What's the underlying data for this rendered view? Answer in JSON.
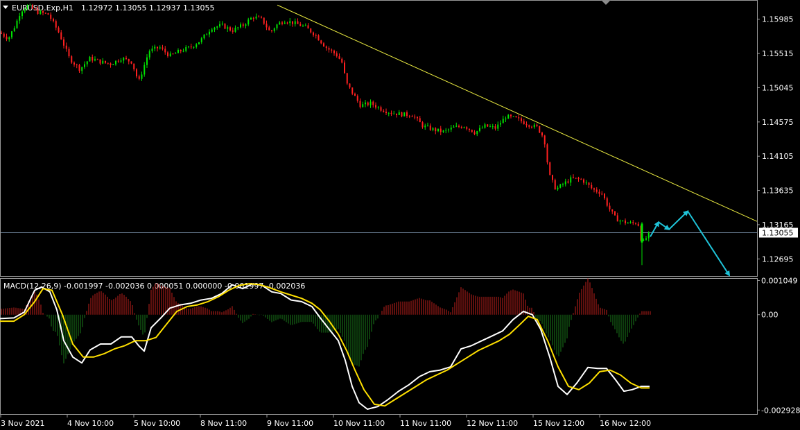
{
  "header": {
    "symbol": "EURUSD.Exp,H1",
    "ohlc": "1.12972 1.13055 1.12937 1.13055"
  },
  "macd_header": {
    "text": "MACD(12,26,9) -0.001997 -0.002036 0.000051 0.000000 -0.001997 -0.002036"
  },
  "chart_data": [
    {
      "type": "candlestick",
      "title": "EURUSD.Exp,H1",
      "ylim": [
        1.1246,
        1.1623
      ],
      "y_ticks": [
        "1.15985",
        "1.15515",
        "1.15045",
        "1.14575",
        "1.14105",
        "1.13635",
        "1.13165",
        "1.12695"
      ],
      "current_price": "1.13055",
      "x_ticks": [
        "3 Nov 2021",
        "4 Nov 10:00",
        "5 Nov 10:00",
        "8 Nov 11:00",
        "9 Nov 11:00",
        "10 Nov 11:00",
        "11 Nov 11:00",
        "12 Nov 11:00",
        "15 Nov 12:00",
        "16 Nov 12:00"
      ],
      "close_path": [
        [
          0,
          1.158
        ],
        [
          12,
          1.1572
        ],
        [
          22,
          1.159
        ],
        [
          30,
          1.161
        ],
        [
          40,
          1.1617
        ],
        [
          55,
          1.1608
        ],
        [
          70,
          1.1605
        ],
        [
          85,
          1.158
        ],
        [
          100,
          1.1545
        ],
        [
          115,
          1.153
        ],
        [
          130,
          1.1545
        ],
        [
          145,
          1.154
        ],
        [
          160,
          1.1537
        ],
        [
          175,
          1.1545
        ],
        [
          190,
          1.154
        ],
        [
          200,
          1.1512
        ],
        [
          215,
          1.1555
        ],
        [
          230,
          1.156
        ],
        [
          245,
          1.1548
        ],
        [
          260,
          1.1555
        ],
        [
          275,
          1.156
        ],
        [
          290,
          1.157
        ],
        [
          305,
          1.1587
        ],
        [
          320,
          1.159
        ],
        [
          335,
          1.1583
        ],
        [
          350,
          1.159
        ],
        [
          365,
          1.1602
        ],
        [
          378,
          1.1598
        ],
        [
          390,
          1.158
        ],
        [
          398,
          1.159
        ],
        [
          410,
          1.1597
        ],
        [
          425,
          1.1593
        ],
        [
          440,
          1.1588
        ],
        [
          455,
          1.1577
        ],
        [
          470,
          1.156
        ],
        [
          485,
          1.155
        ],
        [
          493,
          1.154
        ],
        [
          500,
          1.151
        ],
        [
          510,
          1.1495
        ],
        [
          520,
          1.148
        ],
        [
          535,
          1.1483
        ],
        [
          550,
          1.1475
        ],
        [
          565,
          1.147
        ],
        [
          580,
          1.1468
        ],
        [
          595,
          1.1467
        ],
        [
          610,
          1.1452
        ],
        [
          625,
          1.1447
        ],
        [
          640,
          1.1444
        ],
        [
          655,
          1.145
        ],
        [
          670,
          1.1452
        ],
        [
          685,
          1.1443
        ],
        [
          700,
          1.1452
        ],
        [
          715,
          1.1449
        ],
        [
          730,
          1.1465
        ],
        [
          745,
          1.1462
        ],
        [
          760,
          1.1455
        ],
        [
          775,
          1.145
        ],
        [
          785,
          1.1435
        ],
        [
          792,
          1.1385
        ],
        [
          802,
          1.1365
        ],
        [
          812,
          1.1372
        ],
        [
          825,
          1.138
        ],
        [
          840,
          1.1378
        ],
        [
          855,
          1.1365
        ],
        [
          868,
          1.136
        ],
        [
          878,
          1.134
        ],
        [
          888,
          1.1325
        ],
        [
          900,
          1.132
        ],
        [
          912,
          1.1318
        ],
        [
          920,
          1.132
        ],
        [
          926,
          1.129
        ],
        [
          932,
          1.1298
        ],
        [
          938,
          1.1305
        ]
      ],
      "trendline": [
        [
          400,
          1.1618
        ],
        [
          1092,
          1.1321
        ]
      ],
      "projection_arrows": [
        [
          [
            938,
            1.13
          ],
          [
            950,
            1.132
          ]
        ],
        [
          [
            950,
            1.132
          ],
          [
            965,
            1.131
          ]
        ],
        [
          [
            965,
            1.131
          ],
          [
            992,
            1.1335
          ]
        ],
        [
          [
            992,
            1.1335
          ],
          [
            1052,
            1.1247
          ]
        ]
      ],
      "colors": {
        "bull": "#00e400",
        "bear": "#ff2020",
        "trendline": "#e8e840",
        "arrow": "#1fc3d8",
        "current_line": "#6b7f95"
      }
    },
    {
      "type": "line",
      "title": "MACD(12,26,9)",
      "ylim": [
        -0.00305,
        0.00108
      ],
      "y_ticks": [
        "0.001049",
        "0.00",
        "-0.002928"
      ],
      "series": [
        {
          "name": "MACD",
          "color": "#ffffff",
          "points": [
            [
              0,
              -0.00012
            ],
            [
              20,
              -0.0001
            ],
            [
              35,
              8e-05
            ],
            [
              50,
              0.00075
            ],
            [
              60,
              0.00085
            ],
            [
              72,
              0.0007
            ],
            [
              82,
              0.00015
            ],
            [
              92,
              -0.0008
            ],
            [
              105,
              -0.0013
            ],
            [
              118,
              -0.00148
            ],
            [
              130,
              -0.00108
            ],
            [
              145,
              -0.0009
            ],
            [
              160,
              -0.0009
            ],
            [
              175,
              -0.00068
            ],
            [
              190,
              -0.00068
            ],
            [
              200,
              -0.00095
            ],
            [
              208,
              -0.00112
            ],
            [
              218,
              -0.0004
            ],
            [
              232,
              -0.0001
            ],
            [
              245,
              0.0002
            ],
            [
              260,
              0.0003
            ],
            [
              275,
              0.00035
            ],
            [
              290,
              0.00045
            ],
            [
              305,
              0.0005
            ],
            [
              320,
              0.00065
            ],
            [
              335,
              0.00092
            ],
            [
              350,
              0.0008
            ],
            [
              365,
              0.00095
            ],
            [
              378,
              0.0009
            ],
            [
              392,
              0.0007
            ],
            [
              405,
              0.00065
            ],
            [
              420,
              0.00045
            ],
            [
              435,
              0.0004
            ],
            [
              450,
              0.00025
            ],
            [
              462,
              -0.0001
            ],
            [
              475,
              -0.00045
            ],
            [
              488,
              -0.0008
            ],
            [
              498,
              -0.0014
            ],
            [
              508,
              -0.0022
            ],
            [
              518,
              -0.0027
            ],
            [
              530,
              -0.0029
            ],
            [
              545,
              -0.00282
            ],
            [
              560,
              -0.0026
            ],
            [
              575,
              -0.00235
            ],
            [
              590,
              -0.00215
            ],
            [
              605,
              -0.0019
            ],
            [
              620,
              -0.00175
            ],
            [
              635,
              -0.0017
            ],
            [
              650,
              -0.0016
            ],
            [
              665,
              -0.00105
            ],
            [
              680,
              -0.00095
            ],
            [
              695,
              -0.0008
            ],
            [
              710,
              -0.00065
            ],
            [
              725,
              -0.0005
            ],
            [
              740,
              -0.00015
            ],
            [
              755,
              0.0001
            ],
            [
              768,
              0.0
            ],
            [
              780,
              -0.00045
            ],
            [
              793,
              -0.0013
            ],
            [
              805,
              -0.0022
            ],
            [
              818,
              -0.00245
            ],
            [
              832,
              -0.0021
            ],
            [
              848,
              -0.00162
            ],
            [
              862,
              -0.00165
            ],
            [
              875,
              -0.00165
            ],
            [
              888,
              -0.002
            ],
            [
              900,
              -0.00235
            ],
            [
              912,
              -0.0023
            ],
            [
              925,
              -0.0022
            ],
            [
              937,
              -0.0022
            ]
          ]
        },
        {
          "name": "Signal",
          "color": "#ffe000",
          "points": [
            [
              0,
              -0.0002
            ],
            [
              20,
              -0.0002
            ],
            [
              35,
              0.0
            ],
            [
              50,
              0.0004
            ],
            [
              62,
              0.0008
            ],
            [
              75,
              0.00075
            ],
            [
              90,
              0.0
            ],
            [
              105,
              -0.0009
            ],
            [
              120,
              -0.0013
            ],
            [
              135,
              -0.0013
            ],
            [
              150,
              -0.0012
            ],
            [
              165,
              -0.00105
            ],
            [
              180,
              -0.00095
            ],
            [
              195,
              -0.0008
            ],
            [
              210,
              -0.0008
            ],
            [
              225,
              -0.0007
            ],
            [
              240,
              -0.0003
            ],
            [
              255,
              0.0001
            ],
            [
              270,
              0.00025
            ],
            [
              285,
              0.0003
            ],
            [
              300,
              0.0004
            ],
            [
              315,
              0.00055
            ],
            [
              330,
              0.00075
            ],
            [
              345,
              0.0009
            ],
            [
              360,
              0.00095
            ],
            [
              375,
              0.00092
            ],
            [
              390,
              0.00082
            ],
            [
              405,
              0.0007
            ],
            [
              420,
              0.0006
            ],
            [
              435,
              0.0005
            ],
            [
              450,
              0.00035
            ],
            [
              462,
              0.00015
            ],
            [
              475,
              -0.0002
            ],
            [
              488,
              -0.0006
            ],
            [
              500,
              -0.0011
            ],
            [
              512,
              -0.0017
            ],
            [
              525,
              -0.0023
            ],
            [
              540,
              -0.00275
            ],
            [
              555,
              -0.0028
            ],
            [
              570,
              -0.0026
            ],
            [
              585,
              -0.0024
            ],
            [
              600,
              -0.0022
            ],
            [
              615,
              -0.002
            ],
            [
              630,
              -0.00185
            ],
            [
              645,
              -0.0017
            ],
            [
              660,
              -0.0015
            ],
            [
              675,
              -0.0013
            ],
            [
              690,
              -0.0011
            ],
            [
              705,
              -0.00095
            ],
            [
              720,
              -0.0008
            ],
            [
              735,
              -0.0006
            ],
            [
              750,
              -0.0003
            ],
            [
              762,
              -5e-05
            ],
            [
              775,
              -0.00015
            ],
            [
              790,
              -0.0008
            ],
            [
              805,
              -0.0016
            ],
            [
              820,
              -0.0022
            ],
            [
              835,
              -0.0023
            ],
            [
              850,
              -0.0021
            ],
            [
              865,
              -0.00175
            ],
            [
              880,
              -0.0017
            ],
            [
              895,
              -0.00185
            ],
            [
              910,
              -0.0021
            ],
            [
              925,
              -0.00225
            ],
            [
              937,
              -0.00225
            ]
          ]
        }
      ],
      "histogram_colors": {
        "positive": "#c0201c",
        "negative": "#1a7a1a"
      },
      "histogram_line_color": "#000000"
    }
  ]
}
